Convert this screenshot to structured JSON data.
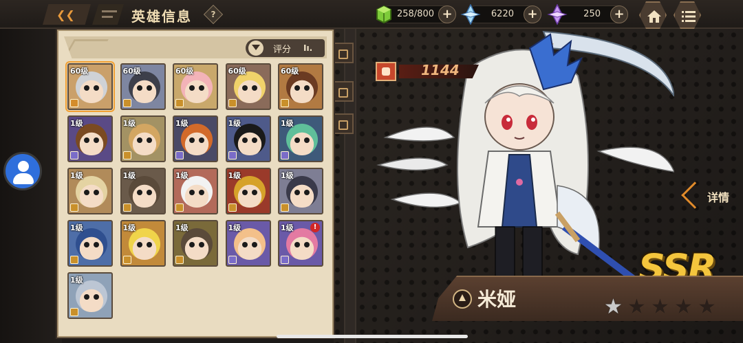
{
  "header": {
    "title": "英雄信息",
    "help_symbol": "?",
    "back_symbol": "❮❮"
  },
  "resources": [
    {
      "icon": "green-gem-icon",
      "value": "258/800",
      "plus": "+"
    },
    {
      "icon": "blue-crystal-icon",
      "value": "6220",
      "plus": "+"
    },
    {
      "icon": "purple-crystal-icon",
      "value": "250",
      "plus": "+"
    }
  ],
  "panel": {
    "sort_label": "评分",
    "sort_symbol": "Iı."
  },
  "heroes": [
    {
      "level": "60级",
      "selected": true,
      "alert": false,
      "hair": "#cfd2d6",
      "bg": "#caa06a",
      "cls": "#d48c2b"
    },
    {
      "level": "60级",
      "selected": false,
      "alert": false,
      "hair": "#3d3f4a",
      "bg": "#7e86a1",
      "cls": "#c9902b"
    },
    {
      "level": "60级",
      "selected": false,
      "alert": false,
      "hair": "#f3b3b8",
      "bg": "#c9a86b",
      "cls": "#c9902b"
    },
    {
      "level": "60级",
      "selected": false,
      "alert": false,
      "hair": "#f0d26a",
      "bg": "#8a6b5a",
      "cls": "#c9902b"
    },
    {
      "level": "60级",
      "selected": false,
      "alert": false,
      "hair": "#6b3b22",
      "bg": "#b27a42",
      "cls": "#c9902b"
    },
    {
      "level": "1级",
      "selected": false,
      "alert": false,
      "hair": "#7a4a22",
      "bg": "#5a4a86",
      "cls": "#7a6cc8"
    },
    {
      "level": "1级",
      "selected": false,
      "alert": false,
      "hair": "#d3a662",
      "bg": "#a39264",
      "cls": "#c9902b"
    },
    {
      "level": "1级",
      "selected": false,
      "alert": false,
      "hair": "#d26a2a",
      "bg": "#4a4a66",
      "cls": "#7a6cc8"
    },
    {
      "level": "1级",
      "selected": false,
      "alert": false,
      "hair": "#1a1a1a",
      "bg": "#4e5a8a",
      "cls": "#7a6cc8"
    },
    {
      "level": "1级",
      "selected": false,
      "alert": false,
      "hair": "#5fbf9a",
      "bg": "#3e5a7a",
      "cls": "#7a6cc8"
    },
    {
      "level": "1级",
      "selected": false,
      "alert": false,
      "hair": "#e4d3a2",
      "bg": "#b18b5a",
      "cls": "#c9902b"
    },
    {
      "level": "1级",
      "selected": false,
      "alert": false,
      "hair": "#5a4a3a",
      "bg": "#6a5a4a",
      "cls": "#c9902b"
    },
    {
      "level": "1级",
      "selected": false,
      "alert": false,
      "hair": "#f2f2f2",
      "bg": "#b36a5a",
      "cls": "#c9902b"
    },
    {
      "level": "1级",
      "selected": false,
      "alert": false,
      "hair": "#d6a22a",
      "bg": "#9a3a2a",
      "cls": "#c9902b"
    },
    {
      "level": "1级",
      "selected": false,
      "alert": false,
      "hair": "#3a3a4a",
      "bg": "#7e7e94",
      "cls": "#c9902b"
    },
    {
      "level": "1级",
      "selected": false,
      "alert": false,
      "hair": "#2f4f8f",
      "bg": "#4e6ea8",
      "cls": "#c9902b"
    },
    {
      "level": "1级",
      "selected": false,
      "alert": false,
      "hair": "#f0d44a",
      "bg": "#c28a3a",
      "cls": "#c9902b"
    },
    {
      "level": "1级",
      "selected": false,
      "alert": false,
      "hair": "#5a4a3a",
      "bg": "#7a6a3a",
      "cls": "#c9902b"
    },
    {
      "level": "1级",
      "selected": false,
      "alert": false,
      "hair": "#f3c08a",
      "bg": "#6a5aa8",
      "cls": "#7a6cc8"
    },
    {
      "level": "1级",
      "selected": false,
      "alert": true,
      "hair": "#e37aa2",
      "bg": "#6a5aa8",
      "cls": "#7a6cc8"
    },
    {
      "level": "1级",
      "selected": false,
      "alert": false,
      "hair": "#bcc6d4",
      "bg": "#8fa2b8",
      "cls": "#c9902b"
    }
  ],
  "detail": {
    "power": "1144",
    "rarity": "SSR",
    "hero_name": "米娅",
    "detail_label": "详情",
    "stars_filled": 1,
    "stars_total": 5
  },
  "colors": {
    "accent": "#e08a2a",
    "panel": "#e9dcc1",
    "rarity": "#f4c53d"
  }
}
